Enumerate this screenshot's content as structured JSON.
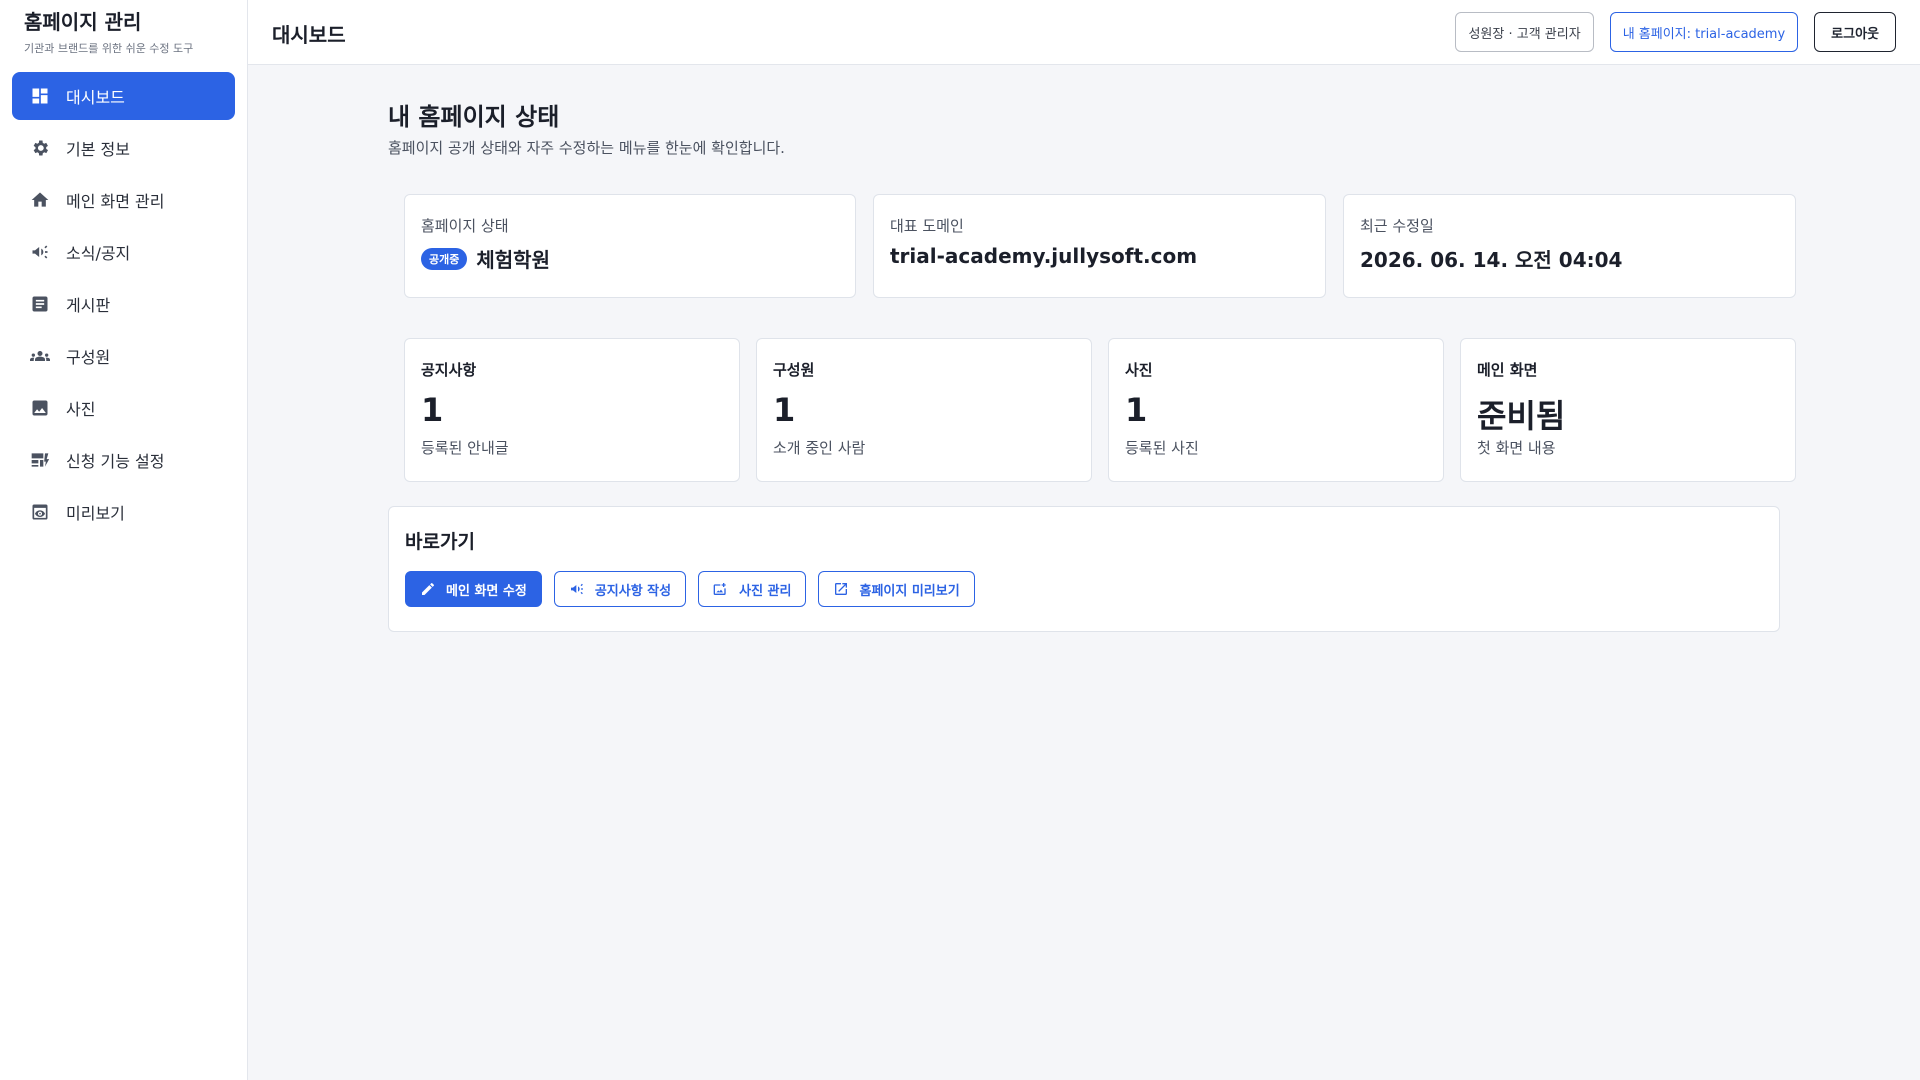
{
  "sidebar": {
    "brand_title": "홈페이지 관리",
    "brand_subtitle": "기관과 브랜드를 위한 쉬운 수정 도구",
    "items": [
      {
        "label": "대시보드",
        "icon": "dashboard-icon",
        "active": true
      },
      {
        "label": "기본 정보",
        "icon": "gear-icon"
      },
      {
        "label": "메인 화면 관리",
        "icon": "home-icon"
      },
      {
        "label": "소식/공지",
        "icon": "megaphone-icon"
      },
      {
        "label": "게시판",
        "icon": "document-icon"
      },
      {
        "label": "구성원",
        "icon": "people-icon"
      },
      {
        "label": "사진",
        "icon": "image-icon"
      },
      {
        "label": "신청 기능 설정",
        "icon": "form-settings-icon"
      },
      {
        "label": "미리보기",
        "icon": "preview-icon"
      }
    ]
  },
  "topbar": {
    "title": "대시보드",
    "role": "성원장 · 고객 관리자",
    "site": "내 홈페이지: trial-academy",
    "logout": "로그아웃"
  },
  "main": {
    "title": "내 홈페이지 상태",
    "subtitle": "홈페이지 공개 상태와 자주 수정하는 메뉴를 한눈에 확인합니다.",
    "info": [
      {
        "label": "홈페이지 상태",
        "badge": "공개중",
        "value": "체험학원"
      },
      {
        "label": "대표 도메인",
        "value": "trial-academy.jullysoft.com"
      },
      {
        "label": "최근 수정일",
        "value": "2026. 06. 14. 오전 04:04"
      }
    ],
    "stats": [
      {
        "label": "공지사항",
        "value": "1",
        "desc": "등록된 안내글"
      },
      {
        "label": "구성원",
        "value": "1",
        "desc": "소개 중인 사람"
      },
      {
        "label": "사진",
        "value": "1",
        "desc": "등록된 사진"
      },
      {
        "label": "메인 화면",
        "value": "준비됨",
        "desc": "첫 화면 내용"
      }
    ],
    "shortcuts": {
      "title": "바로가기",
      "buttons": [
        {
          "label": "메인 화면 수정",
          "icon": "pencil-icon"
        },
        {
          "label": "공지사항 작성",
          "icon": "megaphone-icon"
        },
        {
          "label": "사진 관리",
          "icon": "add-photo-icon"
        },
        {
          "label": "홈페이지 미리보기",
          "icon": "external-link-icon"
        }
      ]
    }
  },
  "colors": {
    "accent": "#2c63e4",
    "background": "#f5f6f9"
  }
}
